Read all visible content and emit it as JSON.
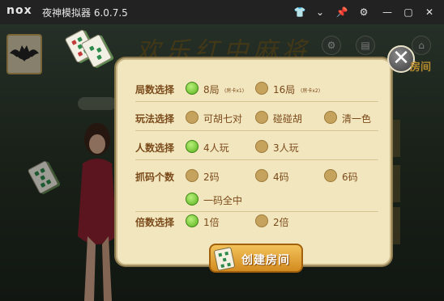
{
  "titlebar": {
    "logo": "nox",
    "title": "夜神模拟器 6.0.7.5"
  },
  "background": {
    "title": "欢乐红中麻将",
    "corner": "房间"
  },
  "dialog": {
    "rows": [
      {
        "label": "局数选择",
        "options": [
          {
            "text": "8局",
            "note": "(房卡x1)",
            "selected": true
          },
          {
            "text": "16局",
            "note": "(房卡x2)",
            "selected": false
          }
        ]
      },
      {
        "label": "玩法选择",
        "options": [
          {
            "text": "可胡七对",
            "selected": false
          },
          {
            "text": "碰碰胡",
            "selected": false
          },
          {
            "text": "清一色",
            "selected": false
          }
        ]
      },
      {
        "label": "人数选择",
        "options": [
          {
            "text": "4人玩",
            "selected": true
          },
          {
            "text": "3人玩",
            "selected": false
          }
        ]
      },
      {
        "label": "抓码个数",
        "options": [
          {
            "text": "2码",
            "selected": false
          },
          {
            "text": "4码",
            "selected": false
          },
          {
            "text": "6码",
            "selected": false
          },
          {
            "text": "一码全中",
            "selected": true
          }
        ]
      },
      {
        "label": "倍数选择",
        "options": [
          {
            "text": "1倍",
            "selected": true
          },
          {
            "text": "2倍",
            "selected": false
          }
        ]
      }
    ],
    "create_label": "创建房间"
  },
  "colors": {
    "accent_green": "#59b21d",
    "label_brown": "#7a4a1a",
    "panel": "#f2e6bf",
    "button_gold": "#d38b1f"
  }
}
